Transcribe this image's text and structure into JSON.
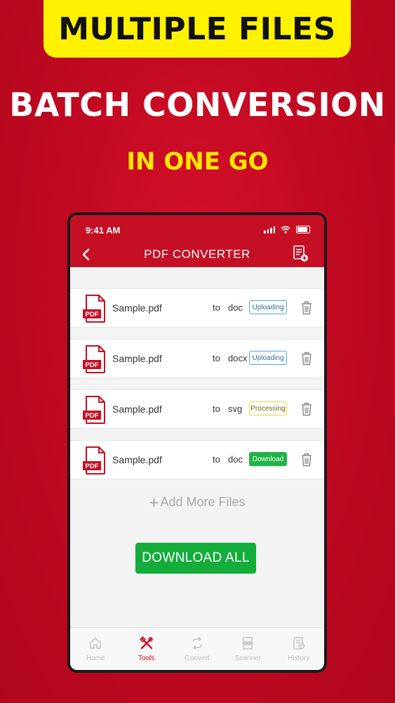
{
  "promo": {
    "banner": "MULTIPLE FILES",
    "headline": "BATCH CONVERSION",
    "subline": "IN ONE GO"
  },
  "status_bar": {
    "time": "9:41 AM"
  },
  "app_bar": {
    "title": "PDF CONVERTER",
    "back_icon": "chevron-left-icon",
    "action_icon": "document-add-icon"
  },
  "files": [
    {
      "name": "Sample.pdf",
      "to": "to",
      "format": "doc",
      "status": "Uploading",
      "status_type": "uploading"
    },
    {
      "name": "Sample.pdf",
      "to": "to",
      "format": "docx",
      "status": "Uploading",
      "status_type": "uploading"
    },
    {
      "name": "Sample.pdf",
      "to": "to",
      "format": "svg",
      "status": "Processing",
      "status_type": "processing"
    },
    {
      "name": "Sample.pdf",
      "to": "to",
      "format": "doc",
      "status": "Download",
      "status_type": "download"
    }
  ],
  "pdf_icon_label": "PDF",
  "add_more": {
    "plus": "+",
    "label": "Add More Files"
  },
  "download_all": "DOWNLOAD ALL",
  "tabs": [
    {
      "label": "Home",
      "icon": "home-icon",
      "active": false
    },
    {
      "label": "Tools",
      "icon": "tools-icon",
      "active": true
    },
    {
      "label": "Convert",
      "icon": "convert-icon",
      "active": false
    },
    {
      "label": "Scanner",
      "icon": "scanner-icon",
      "active": false
    },
    {
      "label": "History",
      "icon": "history-icon",
      "active": false
    }
  ],
  "colors": {
    "brand_red": "#c50f24",
    "banner_yellow": "#fff200",
    "subline_yellow": "#ffe600",
    "download_green": "#14ad3c",
    "uploading_blue": "#4aa8d8",
    "processing_yellow": "#f0d23c"
  }
}
